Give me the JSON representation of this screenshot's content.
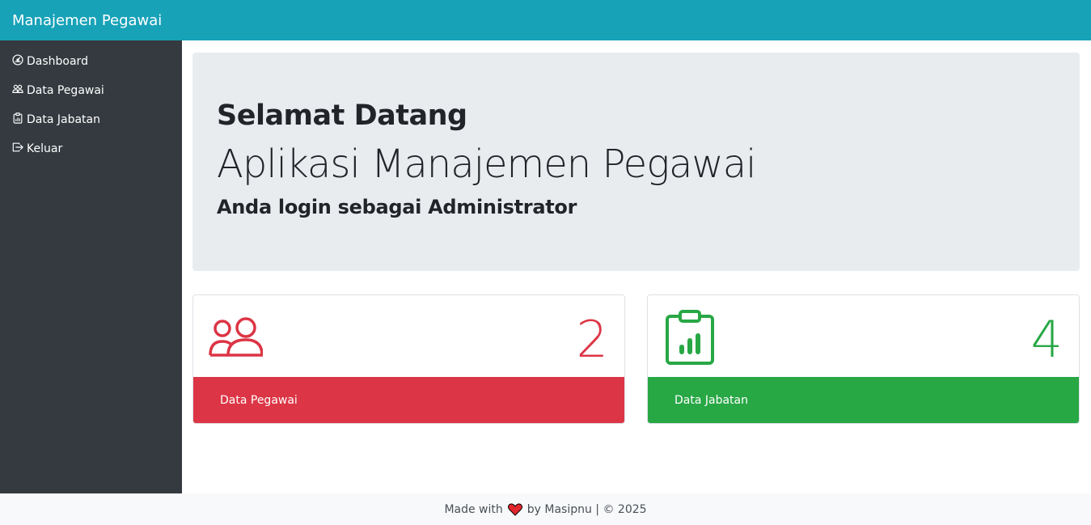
{
  "navbar": {
    "brand": "Manajemen Pegawai"
  },
  "sidebar": {
    "items": [
      {
        "label": "Dashboard",
        "icon": "speedometer-icon"
      },
      {
        "label": "Data Pegawai",
        "icon": "people-icon"
      },
      {
        "label": "Data Jabatan",
        "icon": "clipboard-data-icon"
      },
      {
        "label": "Keluar",
        "icon": "box-arrow-right-icon"
      }
    ]
  },
  "jumbotron": {
    "title": "Selamat Datang",
    "subtitle": "Aplikasi Manajemen Pegawai",
    "login_text": "Anda login sebagai Administrator"
  },
  "cards": [
    {
      "count": "2",
      "label": "Data Pegawai",
      "icon": "people-icon",
      "color": "#dc3545"
    },
    {
      "count": "4",
      "label": "Data Jabatan",
      "icon": "clipboard-data-icon",
      "color": "#28a745"
    }
  ],
  "footer": {
    "made_with": "Made with",
    "by": "by Masipnu | © 2025",
    "heart_color": "#e3262d"
  }
}
